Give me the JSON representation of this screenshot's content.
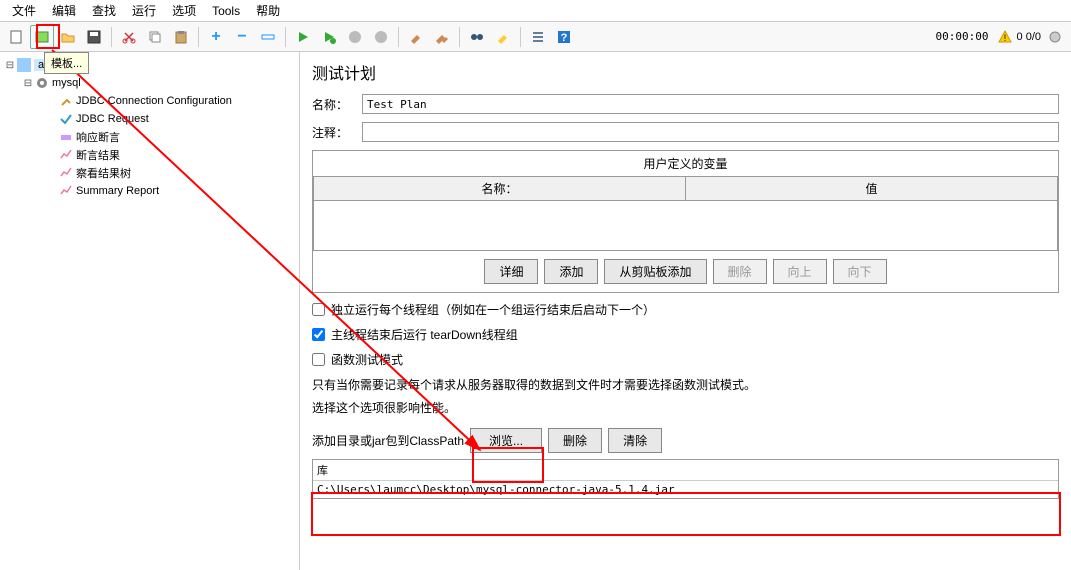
{
  "menu": {
    "file": "文件",
    "edit": "编辑",
    "search": "查找",
    "run": "运行",
    "options": "选项",
    "tools": "Tools",
    "help": "帮助"
  },
  "tooltip": "模板...",
  "timer": "00:00:00",
  "warn_count": "0  0/0",
  "tree": {
    "root_selected": "an",
    "mysql": "mysql",
    "jdbc_conn": "JDBC Connection Configuration",
    "jdbc_req": "JDBC Request",
    "assert_resp": "响应断言",
    "assert_result": "断言结果",
    "view_tree": "察看结果树",
    "summary": "Summary Report"
  },
  "content": {
    "title": "测试计划",
    "name_label": "名称：",
    "name_value": "Test Plan",
    "comment_label": "注释：",
    "vars_title": "用户定义的变量",
    "col_name": "名称：",
    "col_value": "值",
    "btn_detail": "详细",
    "btn_add": "添加",
    "btn_clip": "从剪贴板添加",
    "btn_delete": "删除",
    "btn_up": "向上",
    "btn_down": "向下",
    "chk_serial": "独立运行每个线程组（例如在一个组运行结束后启动下一个）",
    "chk_teardown": "主线程结束后运行 tearDown线程组",
    "chk_func": "函数测试模式",
    "note1": "只有当你需要记录每个请求从服务器取得的数据到文件时才需要选择函数测试模式。",
    "note2": "选择这个选项很影响性能。",
    "classpath_label": "添加目录或jar包到ClassPath",
    "btn_browse": "浏览...",
    "btn_del2": "删除",
    "btn_clear": "清除",
    "lib_label": "库",
    "lib_item": "C:\\Users\\laumcc\\Desktop\\mysql-connector-java-5.1.4.jar"
  }
}
